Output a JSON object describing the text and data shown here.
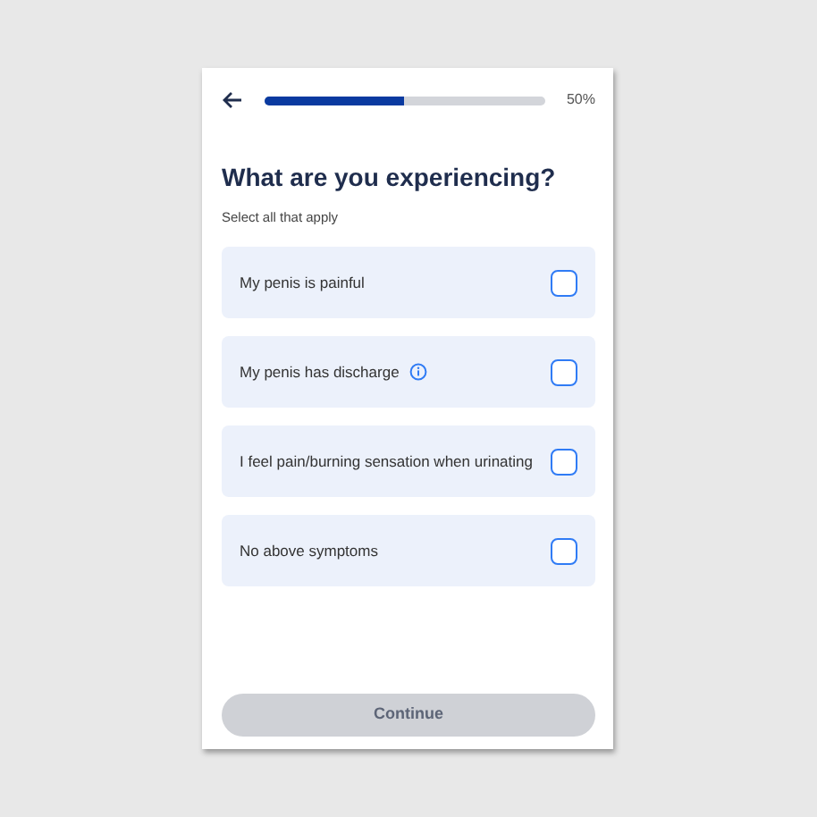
{
  "progress": {
    "level": 0.5,
    "reading": "50%"
  },
  "title": "What are you experiencing?",
  "subtitle": "Select all that apply",
  "options": [
    {
      "label": "My penis is painful",
      "info": false,
      "checked": false
    },
    {
      "label": "My penis has discharge",
      "info": true,
      "checked": false
    },
    {
      "label": "I feel pain/burning sensation when urinating",
      "info": false,
      "checked": false
    },
    {
      "label": "No above symptoms",
      "info": false,
      "checked": false
    }
  ],
  "continue_button": {
    "label": "Continue",
    "disabled": true
  }
}
